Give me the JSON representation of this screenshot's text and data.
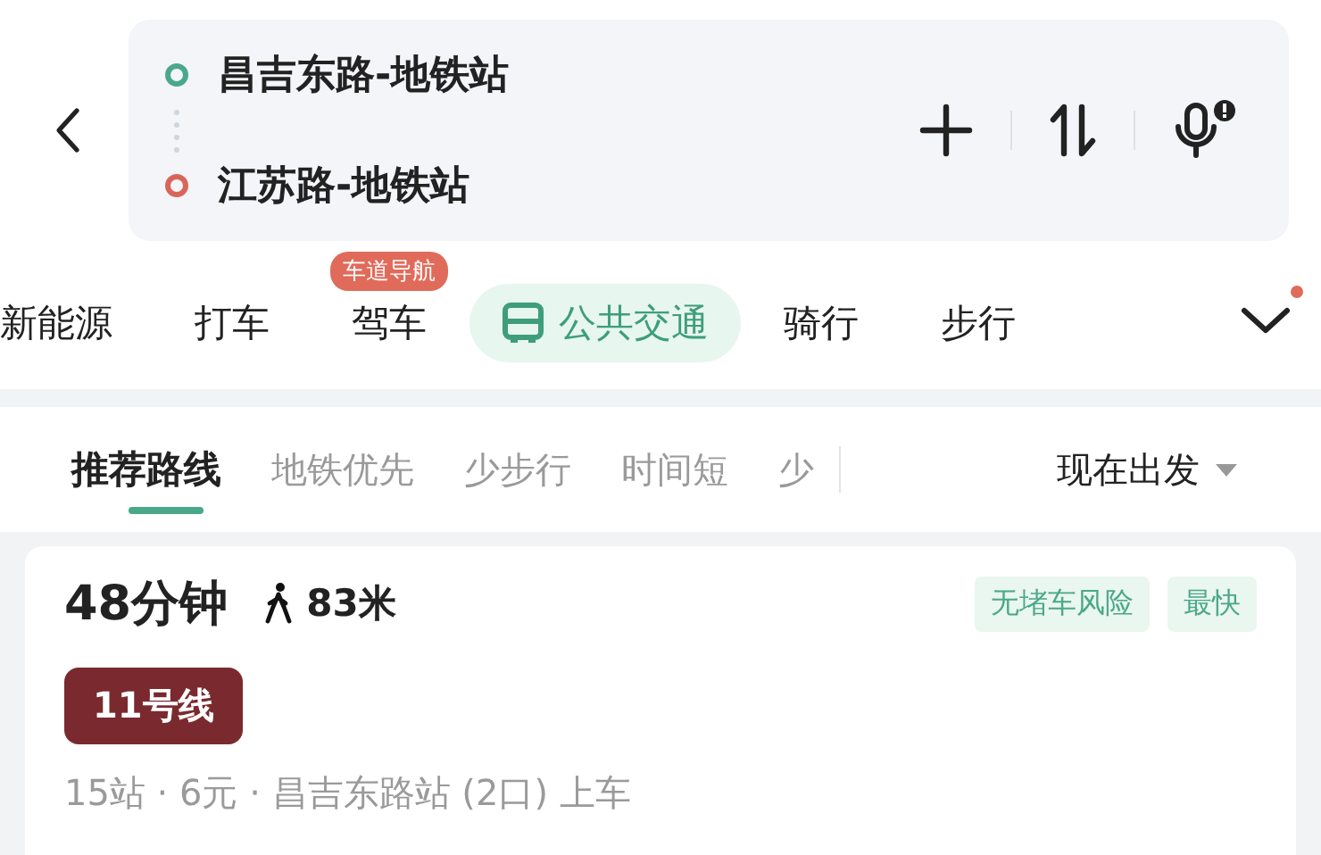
{
  "route_input": {
    "origin": "昌吉东路-地铁站",
    "destination": "江苏路-地铁站"
  },
  "modes": [
    {
      "label": "新能源",
      "selected": false
    },
    {
      "label": "打车",
      "selected": false
    },
    {
      "label": "驾车",
      "selected": false,
      "badge": "车道导航"
    },
    {
      "label": "公共交通",
      "selected": true
    },
    {
      "label": "骑行",
      "selected": false
    },
    {
      "label": "步行",
      "selected": false
    }
  ],
  "route_tabs": [
    {
      "label": "推荐路线",
      "selected": true
    },
    {
      "label": "地铁优先",
      "selected": false
    },
    {
      "label": "少步行",
      "selected": false
    },
    {
      "label": "时间短",
      "selected": false
    },
    {
      "label": "少",
      "selected": false
    }
  ],
  "departure": "现在出发",
  "route_card": {
    "duration": "48分钟",
    "walk": "83米",
    "tags": [
      "无堵车风险",
      "最快"
    ],
    "line": {
      "name": "11号线",
      "color": "#7a2a2e"
    },
    "details": "15站 · 6元 · 昌吉东路站 (2口) 上车"
  }
}
